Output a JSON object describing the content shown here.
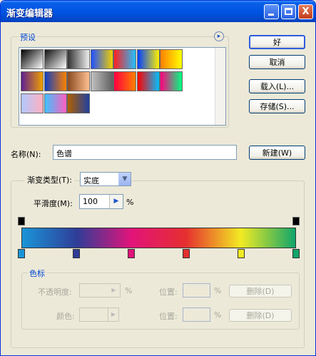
{
  "window": {
    "title": "渐变编辑器",
    "close_glyph": "X"
  },
  "presets": {
    "label": "预设",
    "menu_glyph": "▸",
    "swatches": [
      "linear-gradient(135deg,#000,#fff)",
      "linear-gradient(135deg,#111,#fff0)",
      "linear-gradient(90deg,#333,#eee)",
      "linear-gradient(90deg,#2050ff,#f0d000)",
      "linear-gradient(90deg,#ff2020,#20c0ff)",
      "linear-gradient(90deg,#0040ff,#fff000)",
      "linear-gradient(90deg,#ff8000,#ffff00)",
      "linear-gradient(90deg,#602090,#f0a000)",
      "linear-gradient(90deg,#1040c0,#ff8000)",
      "linear-gradient(90deg,#8a4a20,#ffc090)",
      "linear-gradient(90deg,#c0c0c0,#606060)",
      "linear-gradient(90deg,#ff0040,#ff8000)",
      "linear-gradient(90deg,#ff0000,#00c0ff)",
      "linear-gradient(90deg,#ff0080,#00ff80)",
      "linear-gradient(90deg,#b0c8ff,#ffb0c0)",
      "linear-gradient(90deg,#40c0ff,#ff60c0)",
      "linear-gradient(90deg,#b06000,#2040a0)"
    ]
  },
  "buttons": {
    "ok": "好",
    "cancel": "取消",
    "load": "载入(L)...",
    "save": "存储(S)...",
    "new": "新建(W)",
    "delete": "删除(D)"
  },
  "name": {
    "label": "名称(N):",
    "value": "色谱"
  },
  "gradient_type": {
    "label": "渐变类型(T):",
    "value": "实底"
  },
  "smoothness": {
    "label": "平滑度(M):",
    "value": "100",
    "unit": "%"
  },
  "stops_group": {
    "label": "色标",
    "opacity_label": "不透明度:",
    "color_label": "颜色:",
    "location_label": "位置:",
    "unit": "%"
  },
  "gradient": {
    "colors": [
      "#1a95d7",
      "#2f3d98",
      "#e2147a",
      "#e52f2f",
      "#f3ea23",
      "#11a56a"
    ],
    "stop_positions": [
      0,
      0.2,
      0.4,
      0.6,
      0.8,
      1
    ]
  }
}
